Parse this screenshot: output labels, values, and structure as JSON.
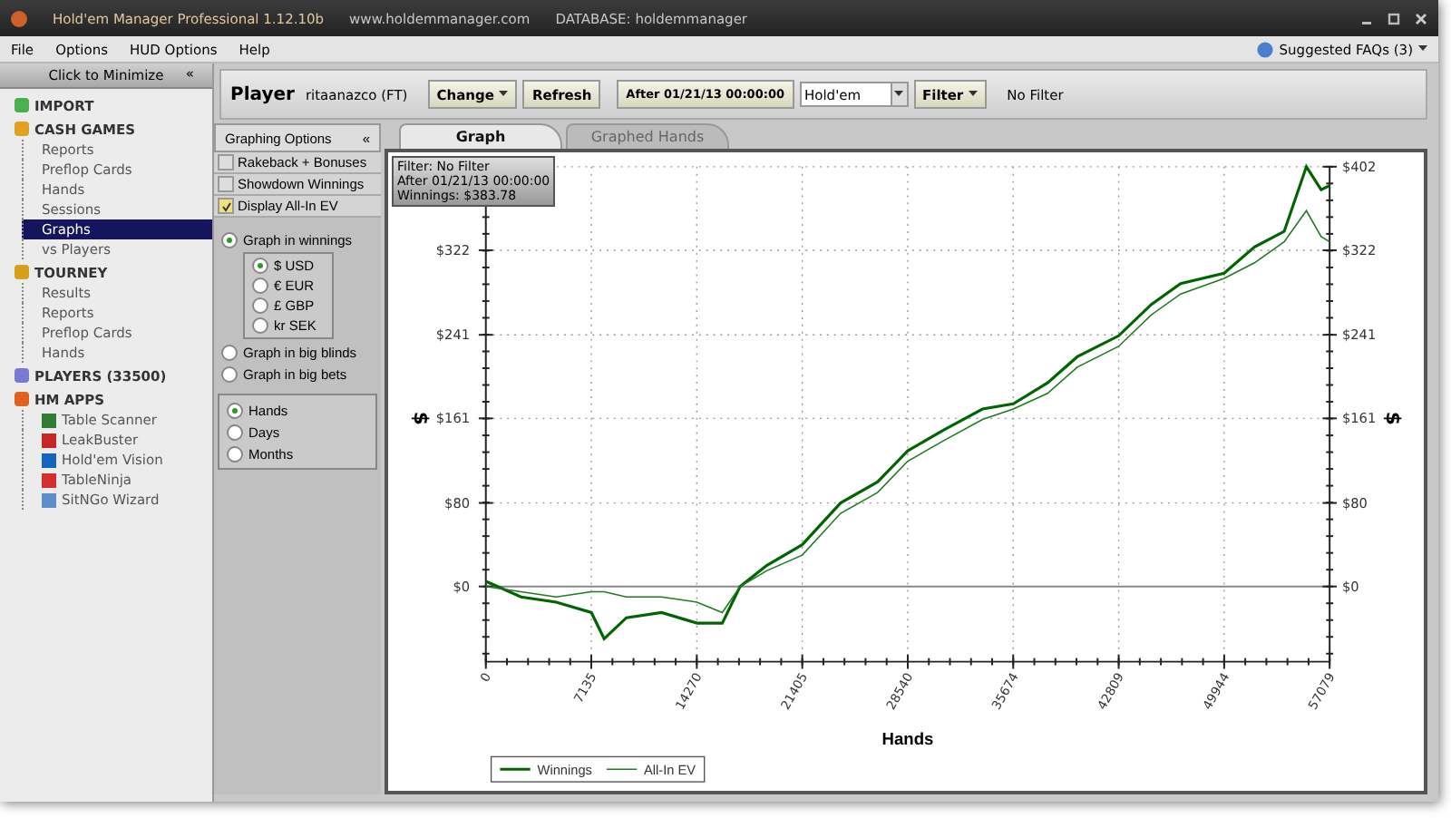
{
  "window": {
    "title": "Hold'em Manager Professional 1.12.10b",
    "website": "www.holdemmanager.com",
    "database": "DATABASE: holdemmanager"
  },
  "menu": {
    "items": [
      "File",
      "Options",
      "HUD Options",
      "Help"
    ],
    "faq": "Suggested FAQs (3)"
  },
  "sidebar": {
    "minimize": "Click to Minimize",
    "collapse": "«",
    "sections": [
      {
        "label": "IMPORT",
        "kind": "import",
        "selected": false
      },
      {
        "label": "CASH GAMES",
        "kind": "cash",
        "selected": false,
        "children": [
          {
            "label": "Reports",
            "selected": false
          },
          {
            "label": "Preflop Cards",
            "selected": false
          },
          {
            "label": "Hands",
            "selected": false
          },
          {
            "label": "Sessions",
            "selected": false
          },
          {
            "label": "Graphs",
            "selected": true
          },
          {
            "label": "vs Players",
            "selected": false
          }
        ]
      },
      {
        "label": "TOURNEY",
        "kind": "tourney",
        "selected": false,
        "children": [
          {
            "label": "Results",
            "selected": false
          },
          {
            "label": "Reports",
            "selected": false
          },
          {
            "label": "Preflop Cards",
            "selected": false
          },
          {
            "label": "Hands",
            "selected": false
          }
        ]
      },
      {
        "label": "PLAYERS (33500)",
        "kind": "players",
        "selected": false
      },
      {
        "label": "HM APPS",
        "kind": "apps",
        "selected": false,
        "children": [
          {
            "label": "Table Scanner",
            "selected": false,
            "color": "#2e7d32"
          },
          {
            "label": "LeakBuster",
            "selected": false,
            "color": "#c62828"
          },
          {
            "label": "Hold'em Vision",
            "selected": false,
            "color": "#1565c0"
          },
          {
            "label": "TableNinja",
            "selected": false,
            "color": "#d32f2f"
          },
          {
            "label": "SitNGo Wizard",
            "selected": false,
            "color": "#5c8fc9"
          }
        ]
      }
    ]
  },
  "toolbar": {
    "player_label": "Player",
    "player": "ritaanazco (FT)",
    "change": "Change",
    "refresh": "Refresh",
    "date": "After 01/21/13 00:00:00",
    "game": "Hold'em",
    "filter": "Filter",
    "filter_value": "No Filter"
  },
  "options": {
    "title": "Graphing Options",
    "collapse": "«",
    "checks": [
      {
        "label": "Rakeback + Bonuses",
        "checked": false
      },
      {
        "label": "Showdown Winnings",
        "checked": false
      },
      {
        "label": "Display All-In EV",
        "checked": true
      }
    ],
    "modes": [
      {
        "label": "Graph in winnings",
        "selected": true
      },
      {
        "label": "Graph in big blinds",
        "selected": false
      },
      {
        "label": "Graph in big bets",
        "selected": false
      }
    ],
    "currencies": [
      {
        "label": "$ USD",
        "selected": true
      },
      {
        "label": "€ EUR",
        "selected": false
      },
      {
        "label": "£ GBP",
        "selected": false
      },
      {
        "label": "kr SEK",
        "selected": false
      }
    ],
    "axis": [
      {
        "label": "Hands",
        "selected": true
      },
      {
        "label": "Days",
        "selected": false
      },
      {
        "label": "Months",
        "selected": false
      }
    ]
  },
  "tabs": [
    {
      "label": "Graph",
      "selected": true
    },
    {
      "label": "Graphed Hands",
      "selected": false
    }
  ],
  "tooltip": [
    "Filter: No Filter",
    "After 01/21/13 00:00:00",
    "Winnings: $383.78"
  ],
  "chart_data": {
    "type": "line",
    "xlabel": "Hands",
    "ylabel": "$",
    "x": [
      0,
      2378,
      4757,
      7135,
      8000,
      9500,
      11890,
      14270,
      16000,
      17200,
      19000,
      21405,
      24000,
      26500,
      28540,
      31000,
      33600,
      35674,
      38000,
      40000,
      42809,
      45000,
      47000,
      49944,
      52000,
      54000,
      55500,
      56500,
      57079
    ],
    "series": [
      {
        "name": "Winnings",
        "color": "#006400",
        "values": [
          5,
          -10,
          -15,
          -25,
          -50,
          -30,
          -25,
          -35,
          -35,
          0,
          20,
          40,
          80,
          100,
          130,
          150,
          170,
          175,
          195,
          220,
          240,
          270,
          290,
          300,
          325,
          340,
          402,
          380,
          384
        ]
      },
      {
        "name": "All-In EV",
        "color": "#1e7b1e",
        "values": [
          0,
          -5,
          -10,
          -5,
          -5,
          -10,
          -10,
          -15,
          -25,
          0,
          15,
          30,
          70,
          90,
          120,
          140,
          160,
          170,
          185,
          210,
          230,
          260,
          280,
          295,
          310,
          330,
          360,
          335,
          330
        ]
      }
    ],
    "xlim": [
      0,
      57079
    ],
    "ylim": [
      -72,
      402
    ],
    "grid": true,
    "legend": true,
    "xticks": [
      0,
      7135,
      14270,
      21405,
      28540,
      35674,
      42809,
      49944,
      57079
    ],
    "yticks": [
      {
        "value": 0,
        "label": "$0"
      },
      {
        "value": 80,
        "label": "$80"
      },
      {
        "value": 161,
        "label": "$161"
      },
      {
        "value": 241,
        "label": "$241"
      },
      {
        "value": 322,
        "label": "$322"
      },
      {
        "value": 402,
        "label": "$402"
      }
    ]
  }
}
